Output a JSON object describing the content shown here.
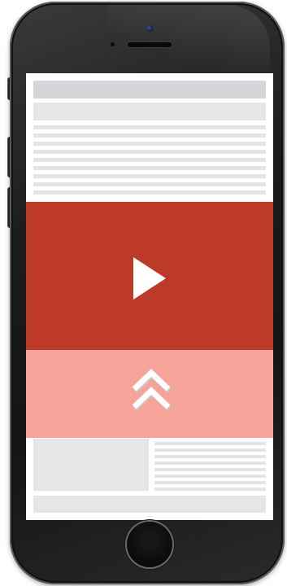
{
  "device": {
    "model": "smartphone",
    "frame_color": "#1c1c1c"
  },
  "screen": {
    "background": "#ffffff",
    "placeholder_color": "#e4e4e6",
    "video_banner": {
      "color": "#be3a28",
      "icon": "play-icon"
    },
    "expand_bar": {
      "color": "#f6a39a",
      "icon": "double-chevron-up-icon"
    }
  }
}
